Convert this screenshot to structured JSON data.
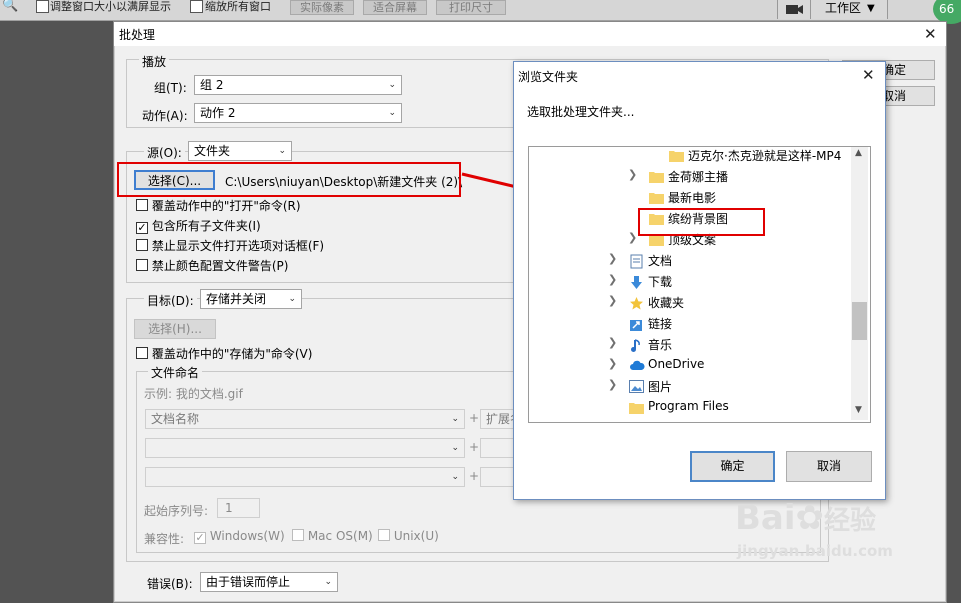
{
  "toolbar": {
    "resize_windows_label": "调整窗口大小以满屏显示",
    "zoom_all_label": "缩放所有窗口",
    "actual_pixels": "实际像素",
    "fit_screen": "适合屏幕",
    "print_size": "打印尺寸",
    "workspace": "工作区",
    "badge": "66"
  },
  "batch": {
    "title": "批处理",
    "ok": "确定",
    "cancel": "取消",
    "play_group": "播放",
    "set_label": "组(T):",
    "set_value": "组 2",
    "action_label": "动作(A):",
    "action_value": "动作 2",
    "source_label": "源(O):",
    "source_value": "文件夹",
    "choose_button": "选择(C)...",
    "source_path": "C:\\Users\\niuyan\\Desktop\\新建文件夹 (2)\\",
    "source_options": [
      {
        "label": "覆盖动作中的\"打开\"命令(R)",
        "checked": false
      },
      {
        "label": "包含所有子文件夹(I)",
        "checked": true
      },
      {
        "label": "禁止显示文件打开选项对话框(F)",
        "checked": false
      },
      {
        "label": "禁止颜色配置文件警告(P)",
        "checked": false
      }
    ],
    "dest_label": "目标(D):",
    "dest_value": "存储并关闭",
    "dest_choose": "选择(H)...",
    "override_save_as": "覆盖动作中的\"存储为\"命令(V)",
    "file_naming": "文件命名",
    "example": "示例: 我的文档.gif",
    "naming_field1": "文档名称",
    "naming_field2": "扩展名",
    "start_serial_label": "起始序列号:",
    "start_serial_value": "1",
    "compat_label": "兼容性:",
    "compat_options": [
      {
        "label": "Windows(W)",
        "checked": true
      },
      {
        "label": "Mac OS(M)",
        "checked": false
      },
      {
        "label": "Unix(U)",
        "checked": false
      }
    ],
    "errors_label": "错误(B):",
    "errors_value": "由于错误而停止"
  },
  "browse": {
    "title": "浏览文件夹",
    "prompt": "选取批处理文件夹...",
    "tree": [
      {
        "label": "迈克尔·杰克逊就是这样-MP4",
        "icon": "folder-icon"
      },
      {
        "label": "金荷娜主播",
        "icon": "folder-icon",
        "expandable": true
      },
      {
        "label": "最新电影",
        "icon": "folder-icon"
      },
      {
        "label": "缤纷背景图",
        "icon": "folder-icon",
        "selected": true
      },
      {
        "label": "顶级文案",
        "icon": "folder-icon",
        "expandable": true
      },
      {
        "label": "文档",
        "icon": "documents-icon",
        "expandable": true
      },
      {
        "label": "下载",
        "icon": "download-icon",
        "expandable": true
      },
      {
        "label": "收藏夹",
        "icon": "star-icon",
        "expandable": true
      },
      {
        "label": "链接",
        "icon": "link-icon"
      },
      {
        "label": "音乐",
        "icon": "music-icon",
        "expandable": true
      },
      {
        "label": "OneDrive",
        "icon": "cloud-icon",
        "expandable": true
      },
      {
        "label": "图片",
        "icon": "pictures-icon",
        "expandable": true
      },
      {
        "label": "Program Files",
        "icon": "folder-icon"
      }
    ],
    "ok": "确定",
    "cancel": "取消"
  },
  "watermark": {
    "brand": "Bai",
    "brand2": "经验",
    "url": "jingyan.baidu.com"
  },
  "colors": {
    "annotation_red": "#e00000",
    "folder_yellow": "#f6d36b",
    "ok_border": "#4b86c8"
  }
}
